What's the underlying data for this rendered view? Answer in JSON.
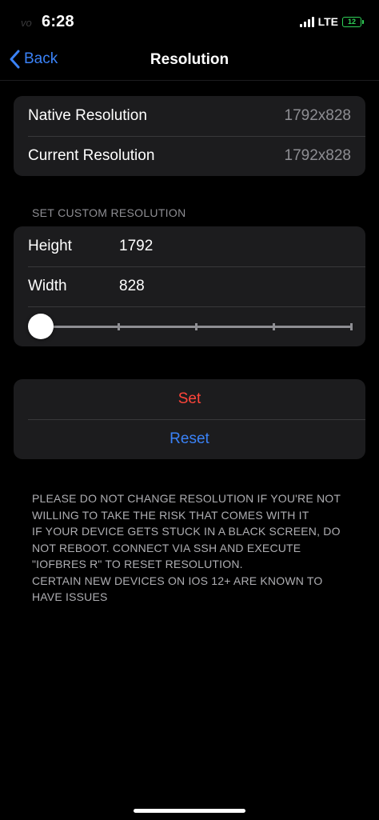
{
  "status_bar": {
    "carrier_mark": "vo",
    "time": "6:28",
    "network": "LTE",
    "battery": "12",
    "battery_color": "#30d158"
  },
  "nav": {
    "back_label": "Back",
    "title": "Resolution",
    "accent_color": "#3a82f7"
  },
  "info_group": {
    "rows": [
      {
        "label": "Native Resolution",
        "value": "1792x828"
      },
      {
        "label": "Current Resolution",
        "value": "1792x828"
      }
    ]
  },
  "custom_section": {
    "header": "SET CUSTOM RESOLUTION",
    "height_label": "Height",
    "height_value": "1792",
    "width_label": "Width",
    "width_value": "828",
    "slider": {
      "value_fraction": 0.0,
      "tick_count": 5
    }
  },
  "actions": {
    "set_label": "Set",
    "set_color": "#ff453a",
    "reset_label": "Reset",
    "reset_color": "#3a82f7"
  },
  "notice": {
    "lines": [
      "PLEASE DO NOT CHANGE RESOLUTION IF YOU'RE NOT WILLING TO TAKE THE RISK THAT COMES WITH IT",
      "IF YOUR DEVICE GETS STUCK IN A BLACK SCREEN, DO NOT REBOOT. CONNECT VIA SSH AND EXECUTE \"IOFBRES R\" TO RESET RESOLUTION.",
      "CERTAIN NEW DEVICES ON IOS 12+ ARE KNOWN TO HAVE ISSUES"
    ]
  }
}
